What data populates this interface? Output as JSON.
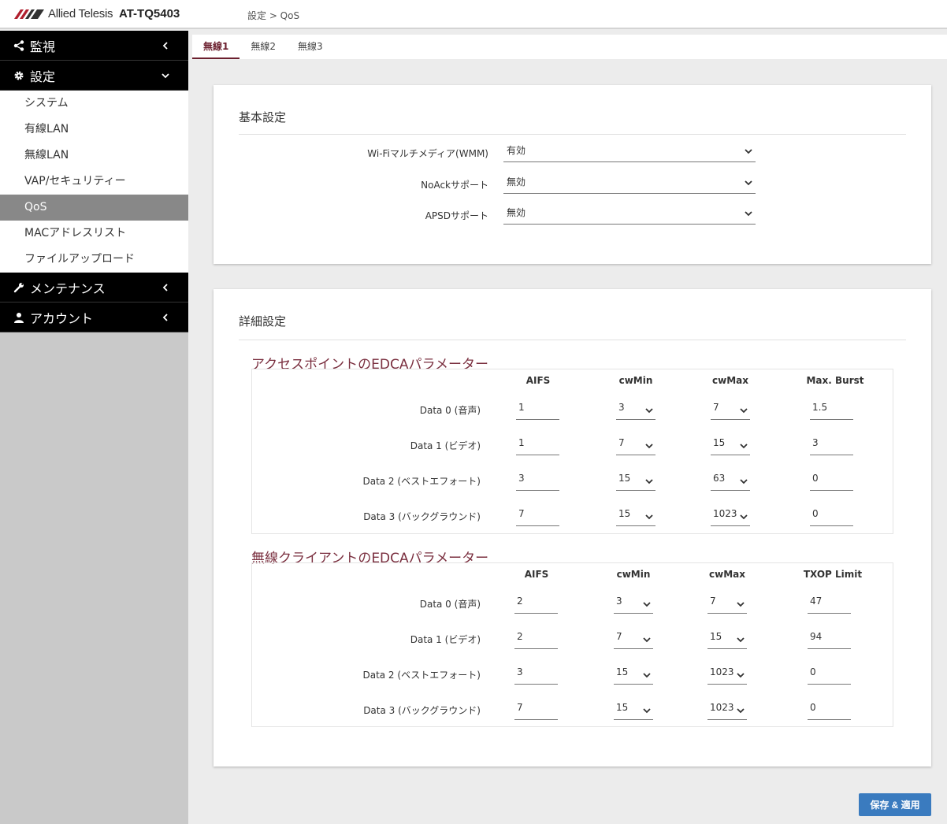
{
  "header": {
    "brand": "Allied Telesis",
    "model": "AT-TQ5403",
    "breadcrumb": "設定 > QoS"
  },
  "sidebar": {
    "sections": [
      {
        "label": "監視",
        "icon": "share-icon"
      },
      {
        "label": "設定",
        "icon": "gear-icon"
      },
      {
        "label": "メンテナンス",
        "icon": "wrench-icon"
      },
      {
        "label": "アカウント",
        "icon": "user-icon"
      }
    ],
    "settings_items": [
      "システム",
      "有線LAN",
      "無線LAN",
      "VAP/セキュリティー",
      "QoS",
      "MACアドレスリスト",
      "ファイルアップロード"
    ],
    "active_item": "QoS"
  },
  "tabs": [
    "無線1",
    "無線2",
    "無線3"
  ],
  "active_tab": "無線1",
  "basic": {
    "title": "基本設定",
    "rows": [
      {
        "label": "Wi-Fiマルチメディア(WMM)",
        "value": "有効"
      },
      {
        "label": "NoAckサポート",
        "value": "無効"
      },
      {
        "label": "APSDサポート",
        "value": "無効"
      }
    ]
  },
  "detail": {
    "title": "詳細設定",
    "ap": {
      "title": "アクセスポイントのEDCAパラメーター",
      "headers": [
        "AIFS",
        "cwMin",
        "cwMax",
        "Max. Burst"
      ],
      "rows": [
        {
          "label": "Data 0 (音声)",
          "aifs": "1",
          "cwmin": "3",
          "cwmax": "7",
          "last": "1.5"
        },
        {
          "label": "Data 1 (ビデオ)",
          "aifs": "1",
          "cwmin": "7",
          "cwmax": "15",
          "last": "3"
        },
        {
          "label": "Data 2 (ベストエフォート)",
          "aifs": "3",
          "cwmin": "15",
          "cwmax": "63",
          "last": "0"
        },
        {
          "label": "Data 3 (バックグラウンド)",
          "aifs": "7",
          "cwmin": "15",
          "cwmax": "1023",
          "last": "0"
        }
      ]
    },
    "client": {
      "title": "無線クライアントのEDCAパラメーター",
      "headers": [
        "AIFS",
        "cwMin",
        "cwMax",
        "TXOP Limit"
      ],
      "rows": [
        {
          "label": "Data 0 (音声)",
          "aifs": "2",
          "cwmin": "3",
          "cwmax": "7",
          "last": "47"
        },
        {
          "label": "Data 1 (ビデオ)",
          "aifs": "2",
          "cwmin": "7",
          "cwmax": "15",
          "last": "94"
        },
        {
          "label": "Data 2 (ベストエフォート)",
          "aifs": "3",
          "cwmin": "15",
          "cwmax": "1023",
          "last": "0"
        },
        {
          "label": "Data 3 (バックグラウンド)",
          "aifs": "7",
          "cwmin": "15",
          "cwmax": "1023",
          "last": "0"
        }
      ]
    }
  },
  "save_label": "保存 & 適用",
  "colors": {
    "accent": "#6b1f2e",
    "button": "#3a7bbf",
    "sidebar": "#c9c9c9"
  }
}
